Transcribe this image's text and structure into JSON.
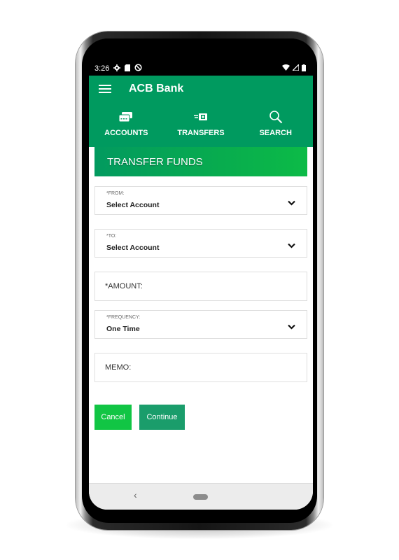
{
  "status_bar": {
    "time": "3:26",
    "left_icons": [
      "gear-icon",
      "sd-card-icon",
      "no-disturb-icon"
    ],
    "right_icons": [
      "wifi-icon",
      "signal-icon",
      "battery-icon"
    ]
  },
  "app_bar": {
    "title": "ACB Bank",
    "menu_icon": "hamburger-menu-icon",
    "tabs": [
      {
        "label": "ACCOUNTS",
        "icon": "cards-icon"
      },
      {
        "label": "TRANSFERS",
        "icon": "money-transfer-icon"
      },
      {
        "label": "SEARCH",
        "icon": "search-icon"
      }
    ]
  },
  "page": {
    "title": "TRANSFER FUNDS"
  },
  "form": {
    "from": {
      "label": "*FROM:",
      "value": "Select Account"
    },
    "to": {
      "label": "*TO:",
      "value": "Select Account"
    },
    "amount": {
      "label": "*AMOUNT:"
    },
    "frequency": {
      "label": "*FREQUENCY:",
      "value": "One Time"
    },
    "memo": {
      "label": "MEMO:"
    }
  },
  "buttons": {
    "cancel": "Cancel",
    "continue": "Continue"
  },
  "nav_bar": {
    "back": "‹"
  },
  "colors": {
    "brand_green": "#009a5f",
    "cancel_green": "#11c544",
    "continue_green": "#1a9d6b"
  }
}
